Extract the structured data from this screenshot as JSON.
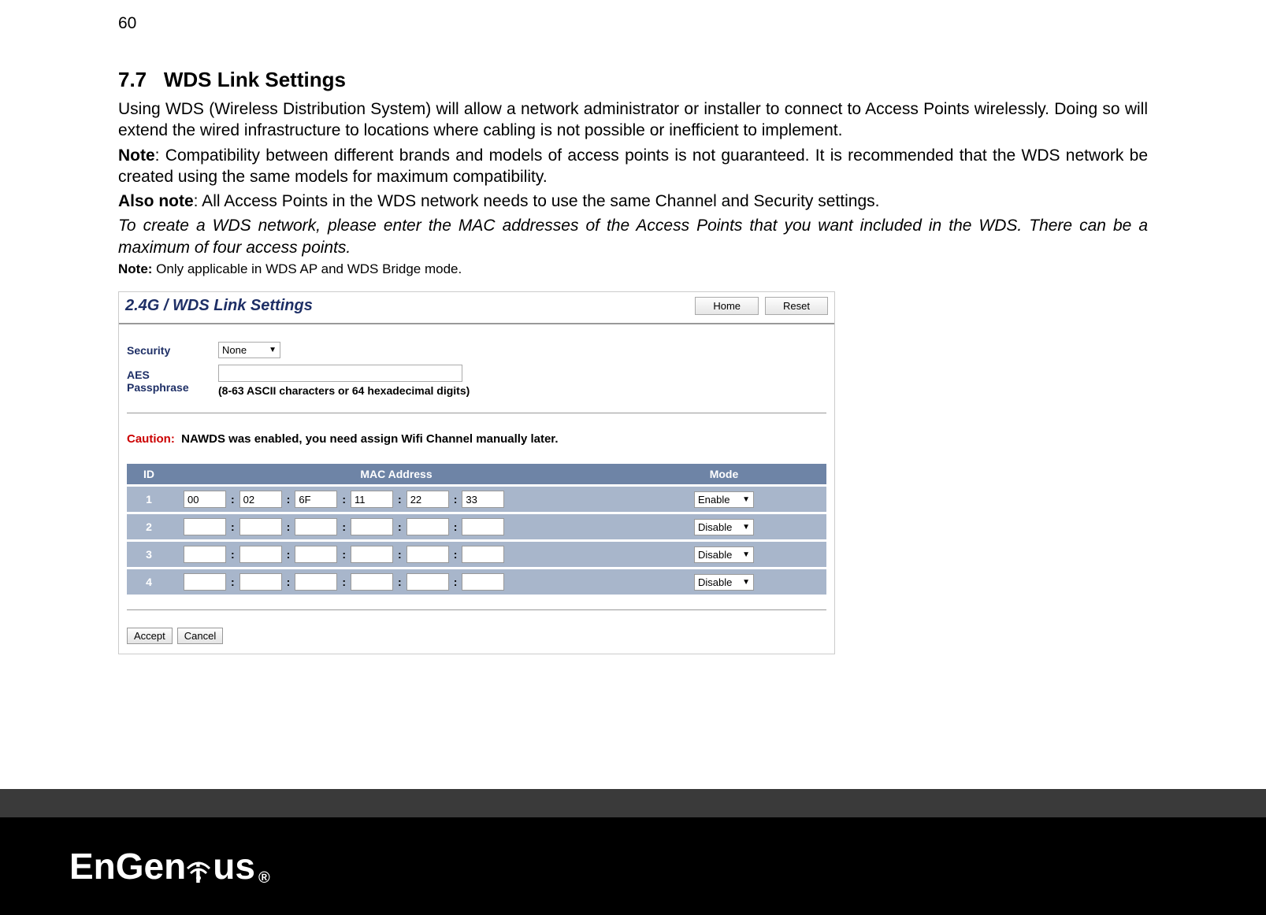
{
  "page_number": "60",
  "section": {
    "number": "7.7",
    "title": "WDS Link Settings"
  },
  "paragraphs": {
    "intro": "Using WDS (Wireless Distribution System) will allow a network administrator or installer to connect to Access Points wirelessly. Doing so will extend the wired infrastructure to locations where cabling is not possible or inefficient to implement.",
    "note_label": "Note",
    "note_text": ": Compatibility between different brands and models of access points is not guaranteed. It is recommended that the WDS network be created using the same models for maximum compatibility.",
    "also_note_label": "Also note",
    "also_note_text": ": All Access Points in the WDS network needs to use the same Channel and Security settings.",
    "italic_text": "To create a WDS network, please enter the MAC addresses of the Access Points that you want included in the WDS. There can be a maximum of four access points.",
    "small_note_label": "Note:",
    "small_note_text": " Only applicable in WDS AP and WDS Bridge mode."
  },
  "screenshot": {
    "title": "2.4G / WDS Link Settings",
    "home_btn": "Home",
    "reset_btn": "Reset",
    "security_label": "Security",
    "security_value": "None",
    "aes_label": "AES Passphrase",
    "aes_hint": "(8-63 ASCII characters or 64 hexadecimal digits)",
    "caution_label": "Caution:",
    "caution_text": "NAWDS was enabled, you need assign Wifi Channel manually later.",
    "headers": {
      "id": "ID",
      "mac": "MAC Address",
      "mode": "Mode"
    },
    "rows": [
      {
        "id": "1",
        "mac": [
          "00",
          "02",
          "6F",
          "11",
          "22",
          "33"
        ],
        "mode": "Enable"
      },
      {
        "id": "2",
        "mac": [
          "",
          "",
          "",
          "",
          "",
          ""
        ],
        "mode": "Disable"
      },
      {
        "id": "3",
        "mac": [
          "",
          "",
          "",
          "",
          "",
          ""
        ],
        "mode": "Disable"
      },
      {
        "id": "4",
        "mac": [
          "",
          "",
          "",
          "",
          "",
          ""
        ],
        "mode": "Disable"
      }
    ],
    "accept_btn": "Accept",
    "cancel_btn": "Cancel"
  },
  "logo_text": {
    "en": "En",
    "gen": "Gen",
    "us": "us"
  }
}
